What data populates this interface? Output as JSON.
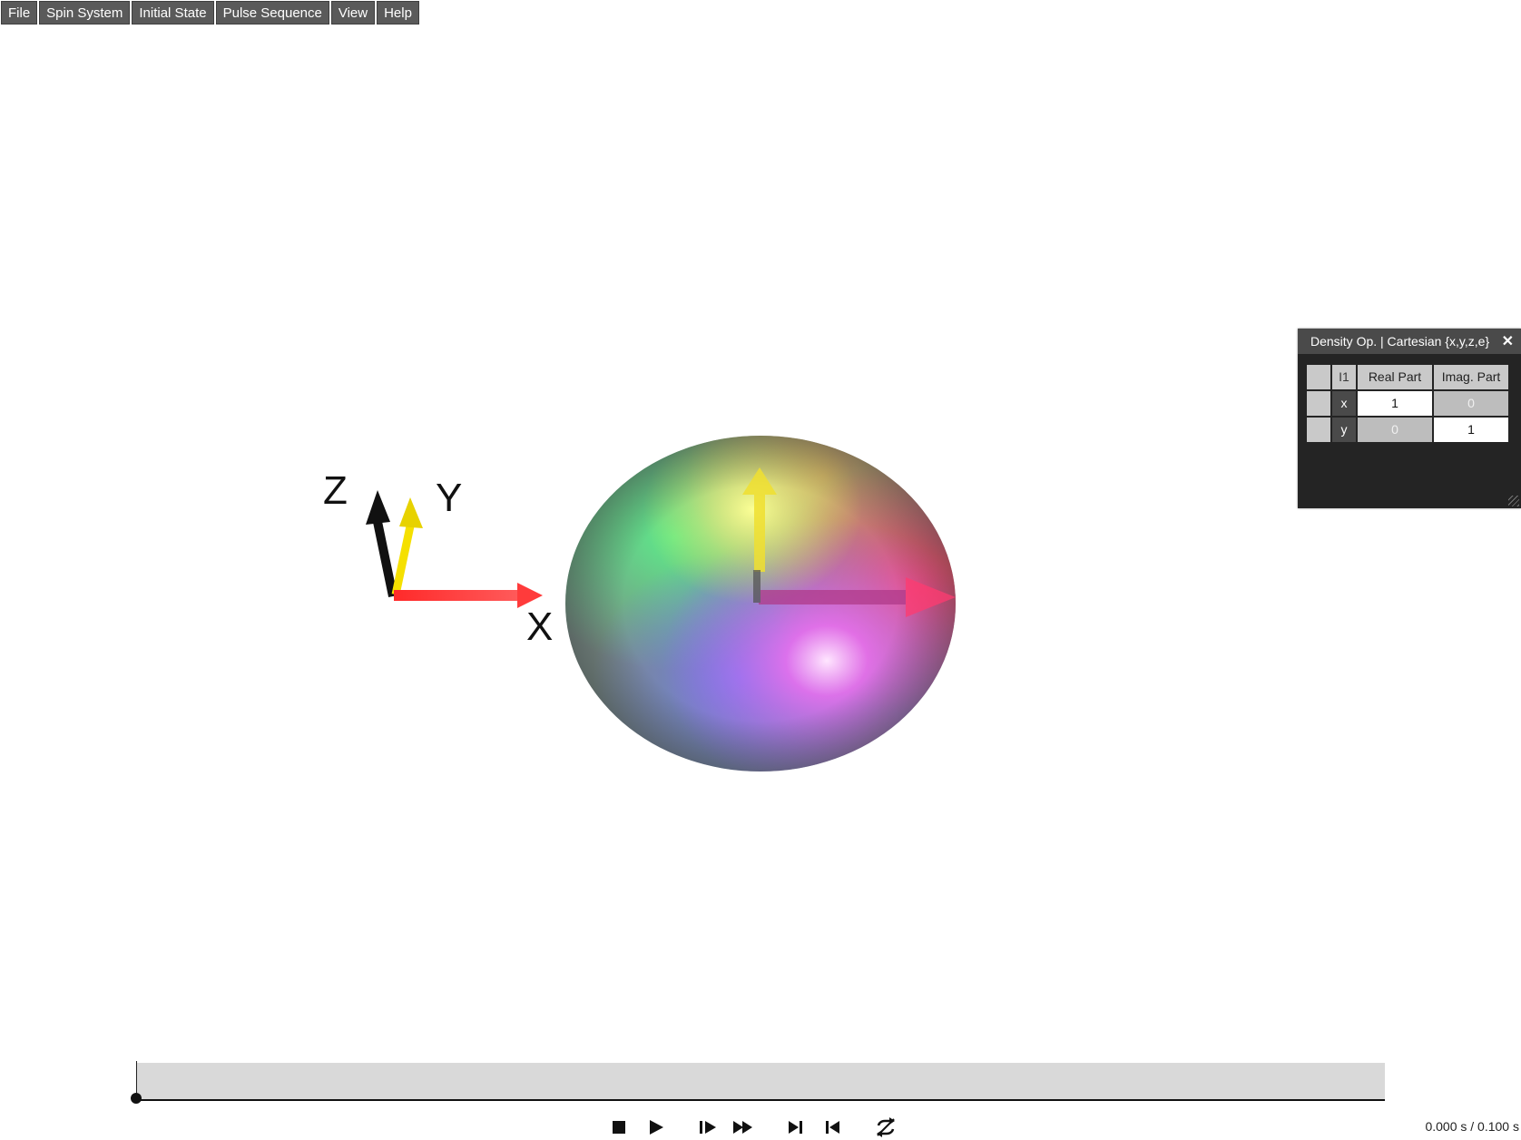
{
  "menu": {
    "items": [
      {
        "label": "File"
      },
      {
        "label": "Spin System"
      },
      {
        "label": "Initial State"
      },
      {
        "label": "Pulse Sequence"
      },
      {
        "label": "View"
      },
      {
        "label": "Help"
      }
    ]
  },
  "scene": {
    "axes": {
      "x_label": "X",
      "y_label": "Y",
      "z_label": "Z"
    },
    "colors": {
      "x_axis": "#ff2a2a",
      "y_axis": "#f5e000",
      "z_axis": "#111111"
    }
  },
  "density_panel": {
    "title": "Density Op. | Cartesian {x,y,z,e}",
    "close_icon": "close-icon",
    "spin_label": "I1",
    "headers": {
      "real": "Real Part",
      "imag": "Imag. Part"
    },
    "rows": [
      {
        "label": "x",
        "real": "1",
        "imag": "0"
      },
      {
        "label": "y",
        "real": "0",
        "imag": "1"
      }
    ]
  },
  "playback": {
    "icons": [
      "stop-icon",
      "play-icon",
      "step-forward-icon",
      "fast-forward-icon",
      "skip-to-end-icon",
      "skip-to-start-icon",
      "loop-icon"
    ],
    "time_readout": "0.000 s / 0.100 s"
  }
}
